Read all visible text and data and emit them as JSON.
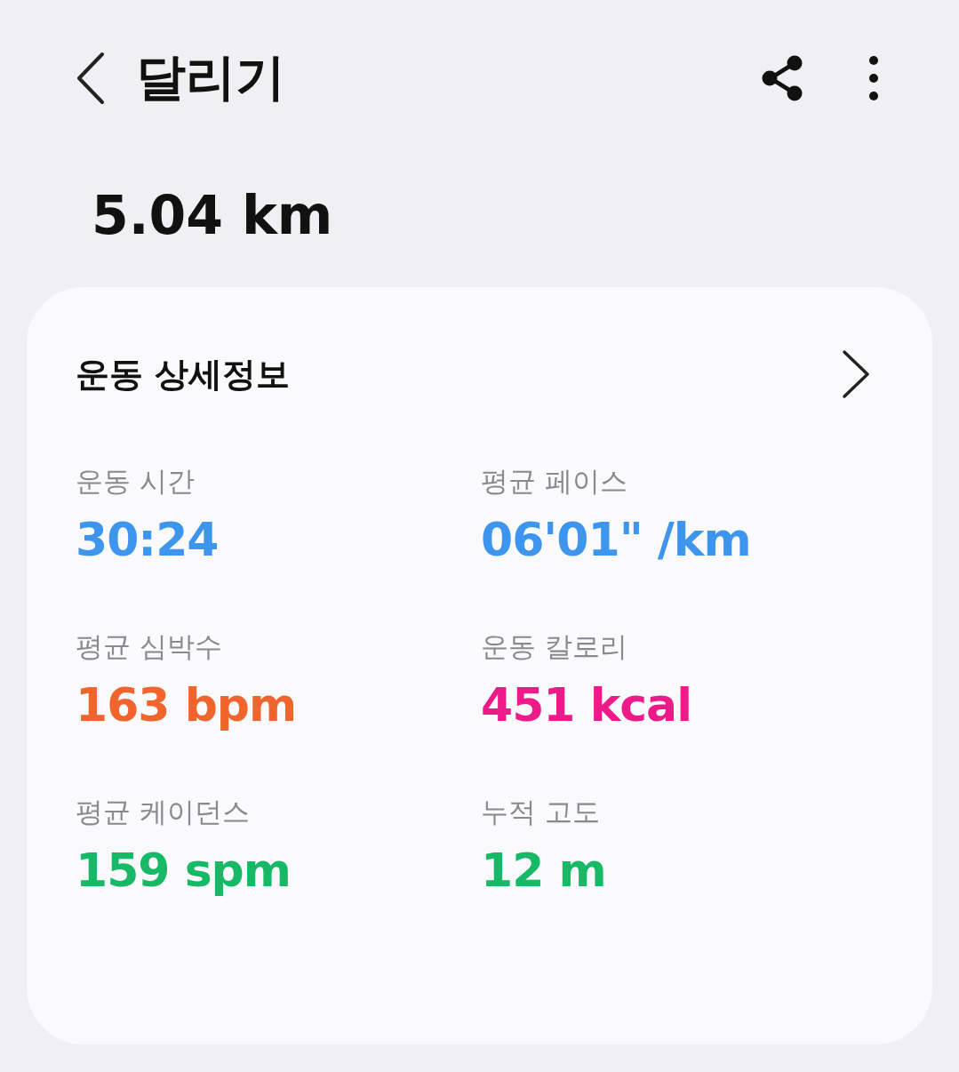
{
  "header": {
    "title": "달리기"
  },
  "distance": "5.04 km",
  "card": {
    "title": "운동 상세정보",
    "stats": [
      {
        "label": "운동 시간",
        "value": "30:24",
        "color": "#3d95ee"
      },
      {
        "label": "평균 페이스",
        "value": "06'01\" /km",
        "color": "#3d95ee"
      },
      {
        "label": "평균 심박수",
        "value": "163 bpm",
        "color": "#f0652d"
      },
      {
        "label": "운동 칼로리",
        "value": "451 kcal",
        "color": "#ee1a8a"
      },
      {
        "label": "평균 케이던스",
        "value": "159 spm",
        "color": "#17b866"
      },
      {
        "label": "누적 고도",
        "value": "12 m",
        "color": "#17b866"
      }
    ]
  }
}
